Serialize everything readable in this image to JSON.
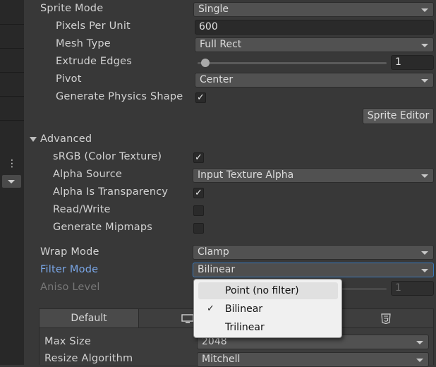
{
  "sprite": {
    "mode_label": "Sprite Mode",
    "mode_value": "Single",
    "ppu_label": "Pixels Per Unit",
    "ppu_value": "600",
    "mesh_label": "Mesh Type",
    "mesh_value": "Full Rect",
    "extrude_label": "Extrude Edges",
    "extrude_value": "1",
    "pivot_label": "Pivot",
    "pivot_value": "Center",
    "physics_label": "Generate Physics Shape",
    "physics_checked": "✓",
    "editor_button": "Sprite Editor"
  },
  "advanced": {
    "header": "Advanced",
    "srgb_label": "sRGB (Color Texture)",
    "srgb_checked": "✓",
    "alpha_source_label": "Alpha Source",
    "alpha_source_value": "Input Texture Alpha",
    "alpha_transparency_label": "Alpha Is Transparency",
    "alpha_transparency_checked": "✓",
    "readwrite_label": "Read/Write",
    "mipmaps_label": "Generate Mipmaps"
  },
  "texture": {
    "wrap_label": "Wrap Mode",
    "wrap_value": "Clamp",
    "filter_label": "Filter Mode",
    "filter_value": "Bilinear",
    "aniso_label": "Aniso Level",
    "aniso_value": "1"
  },
  "filter_menu": {
    "options": [
      "Point (no filter)",
      "Bilinear",
      "Trilinear"
    ],
    "selected_mark": "✓"
  },
  "platform": {
    "default_tab": "Default",
    "max_size_label": "Max Size",
    "max_size_value": "2048",
    "resize_label": "Resize Algorithm",
    "resize_value": "Mitchell"
  },
  "colors": {
    "panel_bg": "#383838",
    "focus_label": "#7aa7e8",
    "focus_border": "#3a79bb"
  }
}
